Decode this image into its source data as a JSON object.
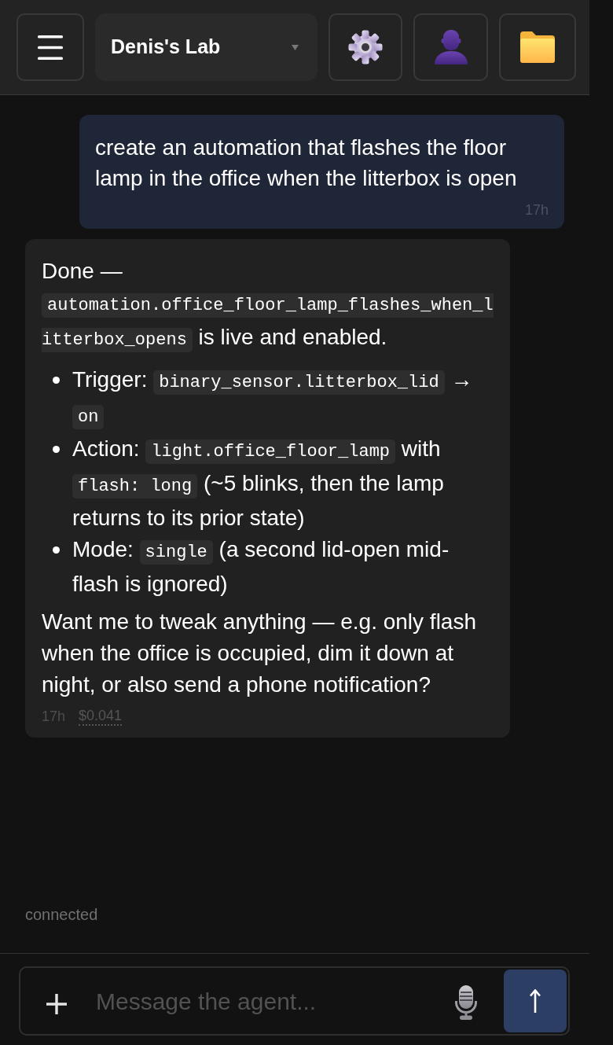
{
  "header": {
    "workspace_select": {
      "value": "Denis's Lab"
    }
  },
  "messages": [
    {
      "kind": "user",
      "blocks": [
        {
          "kind": "paragraph",
          "segments": [
            {
              "kind": "text",
              "text": "create an automation that flashes the floor lamp in the office when the litterbox is open"
            }
          ]
        }
      ],
      "time": "17h"
    },
    {
      "kind": "assistant",
      "blocks": [
        {
          "kind": "paragraph",
          "segments": [
            {
              "kind": "text",
              "text": "Done — "
            },
            {
              "kind": "code",
              "text": "automation.office_floor_lamp_flashes_when_litterbox_opens"
            },
            {
              "kind": "text",
              "text": " is live and enabled."
            }
          ]
        },
        {
          "kind": "list",
          "items": [
            {
              "segments": [
                {
                  "kind": "text",
                  "text": "Trigger: "
                },
                {
                  "kind": "code",
                  "text": "binary_sensor.litterbox_lid"
                },
                {
                  "kind": "text",
                  "text": " → "
                },
                {
                  "kind": "code",
                  "text": "on"
                }
              ]
            },
            {
              "segments": [
                {
                  "kind": "text",
                  "text": "Action: "
                },
                {
                  "kind": "code",
                  "text": "light.office_floor_lamp"
                },
                {
                  "kind": "text",
                  "text": " with "
                },
                {
                  "kind": "code",
                  "text": "flash: long"
                },
                {
                  "kind": "text",
                  "text": " (~5 blinks, then the lamp returns to its prior state)"
                }
              ]
            },
            {
              "segments": [
                {
                  "kind": "text",
                  "text": "Mode: "
                },
                {
                  "kind": "code",
                  "text": "single"
                },
                {
                  "kind": "text",
                  "text": " (a second lid-open mid-flash is ignored)"
                }
              ]
            }
          ]
        },
        {
          "kind": "paragraph",
          "segments": [
            {
              "kind": "text",
              "text": "Want me to tweak anything — e.g. only flash when the office is occupied, dim it down at night, or also send a phone notification?"
            }
          ]
        }
      ],
      "time": "17h",
      "cost": "$0.041"
    }
  ],
  "status": "connected",
  "composer": {
    "placeholder": "Message the agent..."
  }
}
